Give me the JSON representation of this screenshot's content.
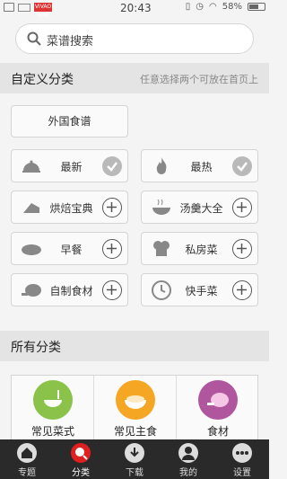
{
  "status_bar": {
    "time": "20:43",
    "carrier_badge": "VIVAO 悦刷",
    "battery": "58%"
  },
  "search": {
    "placeholder": "菜谱搜索"
  },
  "custom_section": {
    "title": "自定义分类",
    "hint": "任意选择两个可放在首页上"
  },
  "foreign_button": {
    "label": "外国食谱"
  },
  "categories": [
    {
      "label": "最新",
      "icon": "cloche-icon",
      "state": "selected"
    },
    {
      "label": "最热",
      "icon": "flame-icon",
      "state": "selected"
    },
    {
      "label": "烘焙宝典",
      "icon": "cake-icon",
      "state": "add"
    },
    {
      "label": "汤羹大全",
      "icon": "soup-icon",
      "state": "add"
    },
    {
      "label": "早餐",
      "icon": "bread-icon",
      "state": "add"
    },
    {
      "label": "私房菜",
      "icon": "chef-hat-icon",
      "state": "add"
    },
    {
      "label": "自制食材",
      "icon": "ham-icon",
      "state": "add"
    },
    {
      "label": "快手菜",
      "icon": "clock-icon",
      "state": "add"
    }
  ],
  "all_section": {
    "title": "所有分类"
  },
  "all_categories": [
    {
      "label": "常见菜式",
      "icon": "bowl-icon",
      "color": "#8bc34a"
    },
    {
      "label": "常见主食",
      "icon": "rice-bowl-icon",
      "color": "#f5a623"
    },
    {
      "label": "食材",
      "icon": "ham-icon",
      "color": "#b0569e"
    }
  ],
  "bottom_nav": [
    {
      "label": "专题",
      "icon": "home-icon",
      "active": false
    },
    {
      "label": "分类",
      "icon": "category-icon",
      "active": true
    },
    {
      "label": "下载",
      "icon": "download-icon",
      "active": false
    },
    {
      "label": "我的",
      "icon": "user-icon",
      "active": false
    },
    {
      "label": "设置",
      "icon": "more-icon",
      "active": false
    }
  ],
  "colors": {
    "nav_bg": "#2a2a2a",
    "active_nav": "#e02020",
    "section_bg": "#e4e4e4"
  }
}
